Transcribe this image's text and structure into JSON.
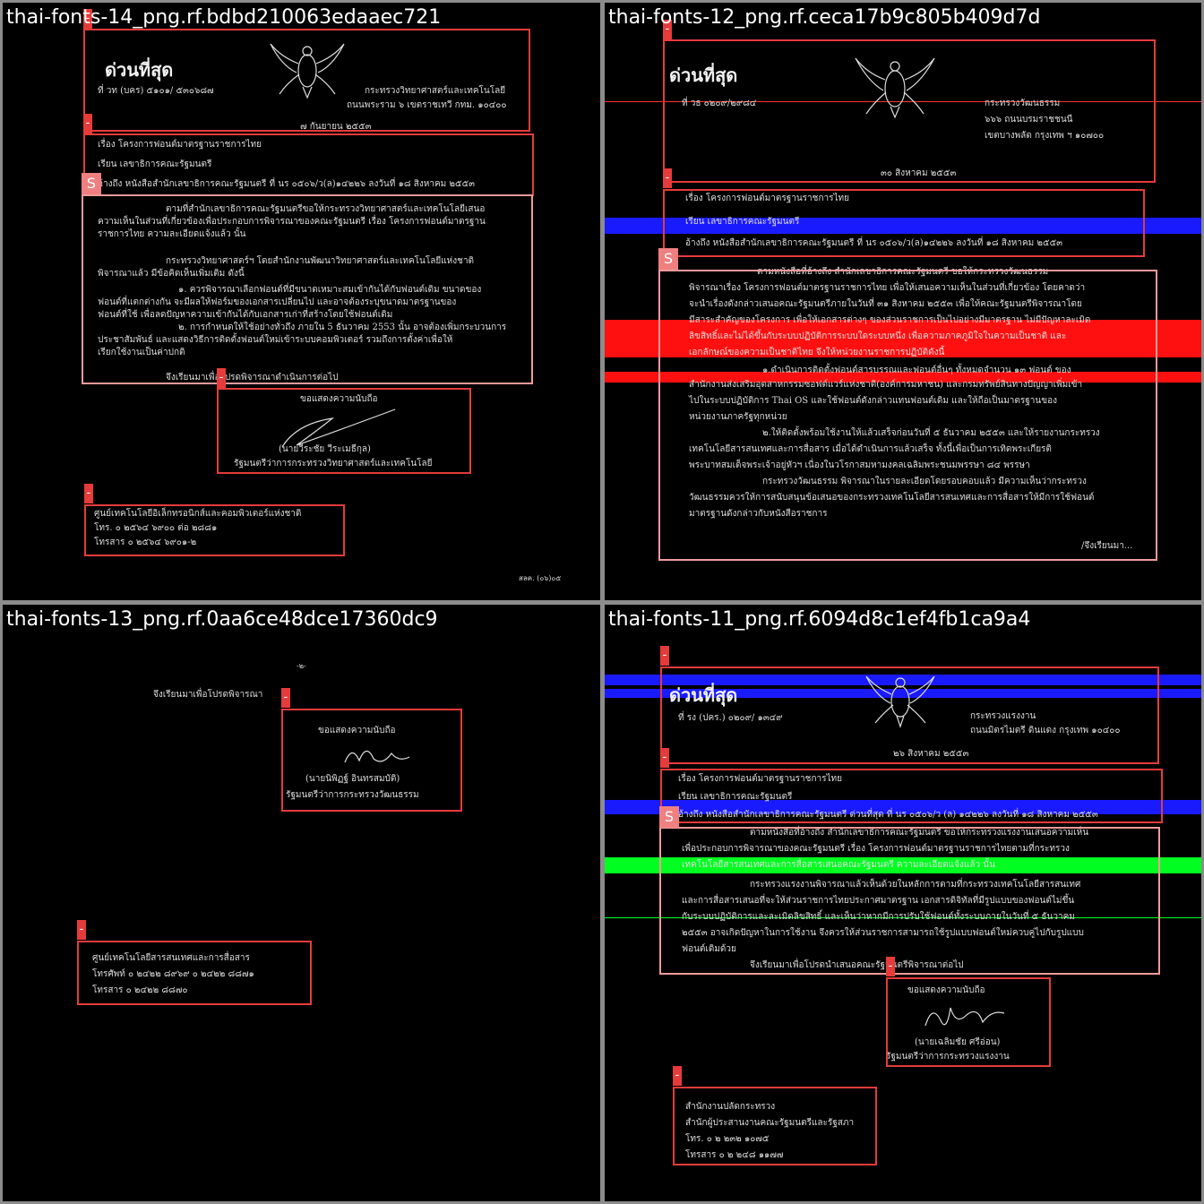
{
  "colors": {
    "box": "#e63b3b",
    "box_light": "#f09a9a",
    "highlight_blue": "#1a1aff",
    "highlight_red": "#ff1010",
    "highlight_green": "#00ff20",
    "frame": "#8c8c8c"
  },
  "panels": [
    {
      "title": "thai-fonts-14_png.rf.bdbd210063edaaec721",
      "urgent": "ด่วนที่สุด",
      "ref": "ที่ วท (บคร) ๕๑๐๑/ ๕๓๐๖๘๗",
      "org": [
        "กระทรวงวิทยาศาสตร์และเทคโนโลยี",
        "ถนนพระราม ๖ เขตราชเทวี กทม. ๑๐๔๐๐"
      ],
      "date": "๗ กันยายน ๒๕๕๓",
      "subject": "เรื่อง   โครงการฟอนต์มาตรฐานราชการไทย",
      "to": "เรียน   เลขาธิการคณะรัฐมนตรี",
      "ref_to": "อ้างถึง  หนังสือสำนักเลขาธิการคณะรัฐมนตรี ที่ นร ๐๕๐๖/ว(ล)๑๔๒๒๖ ลงวันที่ ๑๘ สิงหาคม ๒๕๕๓",
      "body": [
        "ตามที่สำนักเลขาธิการคณะรัฐมนตรีขอให้กระทรวงวิทยาศาสตร์และเทคโนโลยีเสนอ",
        "ความเห็นในส่วนที่เกี่ยวข้องเพื่อประกอบการพิจารณาของคณะรัฐมนตรี เรื่อง โครงการฟอนต์มาตรฐาน",
        "ราชการไทย ความละเอียดแจ้งแล้ว นั้น",
        "",
        "กระทรวงวิทยาศาสตร์ฯ โดยสำนักงานพัฒนาวิทยาศาสตร์และเทคโนโลยีแห่งชาติ",
        "พิจารณาแล้ว มีข้อคิดเห็นเพิ่มเติม ดังนี้",
        "๑. ควรพิจารณาเลือกฟอนต์ที่มีขนาดเหมาะสมเข้ากันได้กับฟอนต์เดิม ขนาดของ",
        "ฟอนต์ที่แตกต่างกัน จะมีผลให้ฟอร์มของเอกสารเปลี่ยนไป และอาจต้องระบุขนาดมาตรฐานของ",
        "ฟอนต์ที่ใช้ เพื่อลดปัญหาความเข้ากันได้กับเอกสารเก่าที่สร้างโดยใช้ฟอนต์เดิม",
        "๒. การกำหนดให้ใช้อย่างทั่วถึง ภายใน 5 ธันวาคม 2553 นั้น อาจต้องเพิ่มกระบวนการ",
        "ประชาสัมพันธ์ และแสดงวิธีการติดตั้งฟอนต์ใหม่เข้าระบบคอมพิวเตอร์ รวมถึงการตั้งค่าเพื่อให้",
        "เรียกใช้งานเป็นค่าปกติ",
        "",
        "จึงเรียนมาเพื่อโปรดพิจารณาดำเนินการต่อไป"
      ],
      "closing": "ขอแสดงความนับถือ",
      "signer": "(นายวีระชัย วีระเมธีกุล)",
      "signer_title": "รัฐมนตรีว่าการกระทรวงวิทยาศาสตร์และเทคโนโลยี",
      "contact": [
        "ศูนย์เทคโนโลยีอิเล็กทรอนิกส์และคอมพิวเตอร์แห่งชาติ",
        "โทร.  ๐ ๒๕๖๔ ๖๙๐๐ ต่อ ๒๘๘๑",
        "โทรสาร   ๐ ๒๕๖๔ ๖๙๐๑-๒"
      ],
      "footer": "สลค. (๐๖)๐๕",
      "tags": {
        "a": "-",
        "b": "-",
        "c": "S",
        "d": "-",
        "e": "-"
      }
    },
    {
      "title": "thai-fonts-12_png.rf.ceca17b9c805b409d7d",
      "urgent": "ด่วนที่สุด",
      "ref": "ที่ วธ ๐๒๐๙/๒๙๘๔",
      "org": [
        "กระทรวงวัฒนธรรม",
        "๖๖๖ ถนนบรมราชชนนี",
        "เขตบางพลัด กรุงเทพ ฯ ๑๐๗๐๐"
      ],
      "date": "๓๐  สิงหาคม ๒๕๕๓",
      "subject": "เรื่อง    โครงการฟอนต์มาตรฐานราชการไทย",
      "to": "เรียน    เลขาธิการคณะรัฐมนตรี",
      "ref_to": "อ้างถึง หนังสือสำนักเลขาธิการคณะรัฐมนตรี ที่ นร ๐๕๐๖/ว(ล)๑๔๒๒๖ ลงวันที่ ๑๘ สิงหาคม ๒๕๕๓",
      "body": [
        "ตามหนังสือที่อ้างถึง สำนักเลขาธิการคณะรัฐมนตรี ขอให้กระทรวงวัฒนธรรม",
        "พิจารณาเรื่อง โครงการฟอนต์มาตรฐานราชการไทย เพื่อให้เสนอความเห็นในส่วนที่เกี่ยวข้อง โดยคาดว่า",
        "จะนำเรื่องดังกล่าวเสนอคณะรัฐมนตรีภายในวันที่ ๓๑ สิงหาคม ๒๕๕๓ เพื่อให้คณะรัฐมนตรีพิจารณาโดย",
        "มีสาระสำคัญของโครงการ เพื่อให้เอกสารต่างๆ ของส่วนราชการเป็นไปอย่างมีมาตรฐาน ไม่มีปัญหาละเมิด",
        "ลิขสิทธิ์และไม่ได้ขึ้นกับระบบปฏิบัติการระบบใดระบบหนึ่ง เพื่อความภาคภูมิใจในความเป็นชาติ และ",
        "เอกลักษณ์ของความเป็นชาติไทย จึงให้หน่วยงานราชการปฏิบัติดังนี้",
        "๑.ดำเนินการติดตั้งฟอนต์สารบรรณและฟอนต์อื่นๆ ทั้งหมดจำนวน ๑๓ ฟอนต์ ของ",
        "สำนักงานส่งเสริมอุตสาหกรรมซอฟต์แวร์แห่งชาติ(องค์การมหาชน) และกรมทรัพย์สินทางปัญญาเพิ่มเข้า",
        "ไปในระบบปฏิบัติการ Thai OS และใช้ฟอนต์ดังกล่าวแทนฟอนต์เดิม และให้ถือเป็นมาตรฐานของ",
        "หน่วยงานภาครัฐทุกหน่วย",
        "๒.ให้ติดตั้งพร้อมใช้งานให้แล้วเสร็จก่อนวันที่ ๕ ธันวาคม ๒๕๕๓ และให้รายงานกระทรวง",
        "เทคโนโลยีสารสนเทศและการสื่อสาร เมื่อได้ดำเนินการแล้วเสร็จ ทั้งนี้เพื่อเป็นการเทิดพระเกียรติ",
        "พระบาทสมเด็จพระเจ้าอยู่หัวฯ เนื่องในวโรกาสมหามงคลเฉลิมพระชนมพรรษา ๘๔ พรรษา",
        "กระทรวงวัฒนธรรม พิจารณาในรายละเอียดโดยรอบคอบแล้ว มีความเห็นว่ากระทรวง",
        "วัฒนธรรมควรให้การสนับสนุนข้อเสนอของกระทรวงเทคโนโลยีสารสนเทศและการสื่อสารให้มีการใช้ฟอนต์",
        "มาตรฐานดังกล่าวกับหนังสือราชการ"
      ],
      "closing": "/จึงเรียนมา...",
      "tags": {
        "a": "-",
        "b": "-",
        "c": "S"
      }
    },
    {
      "title": "thai-fonts-13_png.rf.0aa6ce48dce17360dc9",
      "page_num": "-๒-",
      "body": [
        "จึงเรียนมาเพื่อโปรดพิจารณา"
      ],
      "closing": "ขอแสดงความนับถือ",
      "signer": "(นายนิพิฏฐ์  อินทรสมบัติ)",
      "signer_title": "รัฐมนตรีว่าการกระทรวงวัฒนธรรม",
      "contact": [
        "ศูนย์เทคโนโลยีสารสนเทศและการสื่อสาร",
        "โทรศัพท์ ๐ ๒๔๒๒ ๘๙๖๙  ๐ ๒๔๒๒ ๘๘๗๑",
        "โทรสาร  ๐ ๒๔๒๒ ๘๘๗๐"
      ],
      "tags": {
        "a": "-",
        "b": "-"
      }
    },
    {
      "title": "thai-fonts-11_png.rf.6094d8c1ef4fb1ca9a4",
      "urgent": "ด่วนที่สุด",
      "ref": "ที่ รง (ปคร.) ๐๒๐๙/ ๑๓๔๙",
      "org": [
        "กระทรวงแรงงาน",
        "ถนนมิตรไมตรี ดินแดง กรุงเทพ ๑๐๔๐๐"
      ],
      "date": "๒๖  สิงหาคม  ๒๕๕๓",
      "subject": "เรื่อง  โครงการฟอนต์มาตรฐานราชการไทย",
      "to": "เรียน  เลขาธิการคณะรัฐมนตรี",
      "ref_to": "อ้างถึง  หนังสือสำนักเลขาธิการคณะรัฐมนตรี ด่วนที่สุด ที่ นร ๐๕๐๖/ว (ล) ๑๔๒๒๖ ลงวันที่ ๑๘ สิงหาคม ๒๕๕๓",
      "body": [
        "ตามหนังสือที่อ้างถึง สำนักเลขาธิการคณะรัฐมนตรี ขอให้กระทรวงแรงงานเสนอความเห็น",
        "เพื่อประกอบการพิจารณาของคณะรัฐมนตรี เรื่อง โครงการฟอนต์มาตรฐานราชการไทยตามที่กระทรวง",
        "เทคโนโลยีสารสนเทศและการสื่อสารเสนอคณะรัฐมนตรี ความละเอียดแจ้งแล้ว นั้น",
        "กระทรวงแรงงานพิจารณาแล้วเห็นด้วยในหลักการตามที่กระทรวงเทคโนโลยีสารสนเทศ",
        "และการสื่อสารเสนอที่จะให้ส่วนราชการไทยประกาศมาตรฐาน เอกสารดิจิทัลที่มีรูปแบบของฟอนต์ไม่ขึ้น",
        "กับระบบปฏิบัติการและละเมิดลิขสิทธิ์ และเห็นว่าหากมีการปรับใช้ฟอนต์ทั้งระบบภายในวันที่ ๕ ธันวาคม",
        "๒๕๕๓ อาจเกิดปัญหาในการใช้งาน จึงควรให้ส่วนราชการสามารถใช้รูปแบบฟอนต์ใหม่ควบคู่ไปกับรูปแบบ",
        "ฟอนต์เดิมด้วย",
        "จึงเรียนมาเพื่อโปรดนำเสนอคณะรัฐมนตรีพิจารณาต่อไป"
      ],
      "closing": "ขอแสดงความนับถือ",
      "signer": "(นายเฉลิมชัย  ศรีอ่อน)",
      "signer_title": "รัฐมนตรีว่าการกระทรวงแรงงาน",
      "contact": [
        "สำนักงานปลัดกระทรวง",
        "สำนักผู้ประสานงานคณะรัฐมนตรีและรัฐสภา",
        "โทร. ๐ ๒ ๒๓๒ ๑๐๗๕",
        "โทรสาร ๐ ๒ ๒๔๘ ๑๑๗๗"
      ],
      "tags": {
        "a": "-",
        "b": "-",
        "c": "S",
        "d": "-",
        "e": "-"
      }
    }
  ]
}
